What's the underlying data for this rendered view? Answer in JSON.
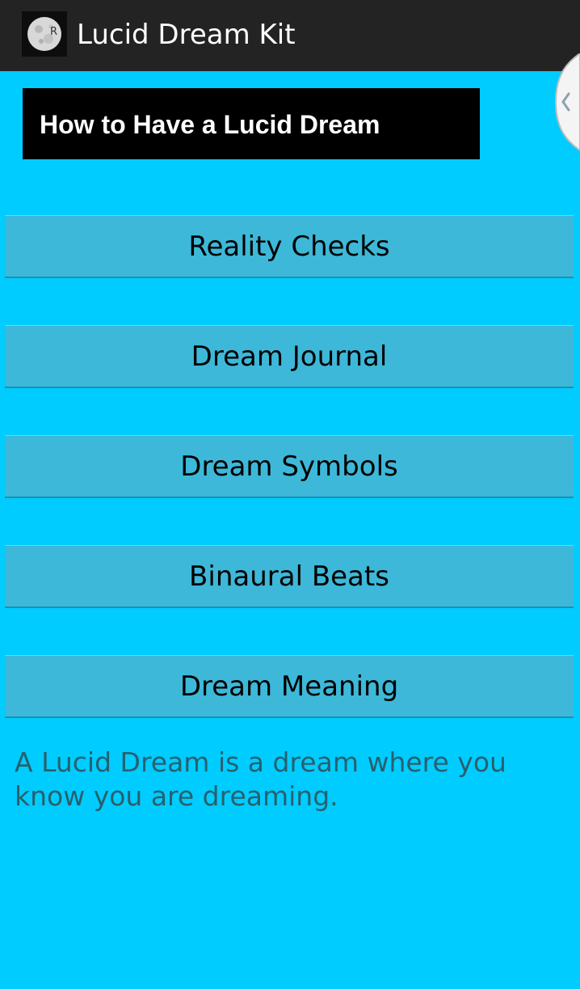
{
  "action_bar": {
    "title": "Lucid Dream Kit",
    "icon": "moon-app-icon",
    "bg_color": "#232323"
  },
  "drawer_handle": {
    "icon": "chevron-left-icon"
  },
  "heading": {
    "text": "How to Have a Lucid Dream"
  },
  "menu": {
    "buttons": [
      {
        "label": "Reality Checks"
      },
      {
        "label": "Dream Journal"
      },
      {
        "label": "Dream Symbols"
      },
      {
        "label": "Binaural Beats"
      },
      {
        "label": "Dream Meaning"
      }
    ]
  },
  "description": "A Lucid Dream is a dream where you know you are dreaming.",
  "colors": {
    "background": "#00ccff",
    "button": "#3db8d8",
    "description_text": "#28606e"
  }
}
